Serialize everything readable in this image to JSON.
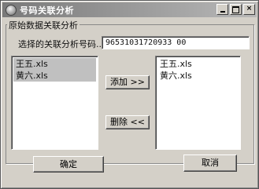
{
  "window": {
    "title": "号码关联分析",
    "minimize_glyph": "",
    "maximize_glyph": "",
    "close_glyph": "×"
  },
  "group": {
    "legend": "原始数据关联分析"
  },
  "field": {
    "label": "选择的关联分析号码...",
    "value": "96531031720933 00"
  },
  "left_list": {
    "items": [
      "王五.xls",
      "黄六.xls"
    ]
  },
  "right_list": {
    "items": [
      "王五.xls",
      "黄六.xls"
    ]
  },
  "buttons": {
    "add": "添加 >>",
    "delete": "删除 <<",
    "ok": "确定",
    "cancel": "取消"
  }
}
